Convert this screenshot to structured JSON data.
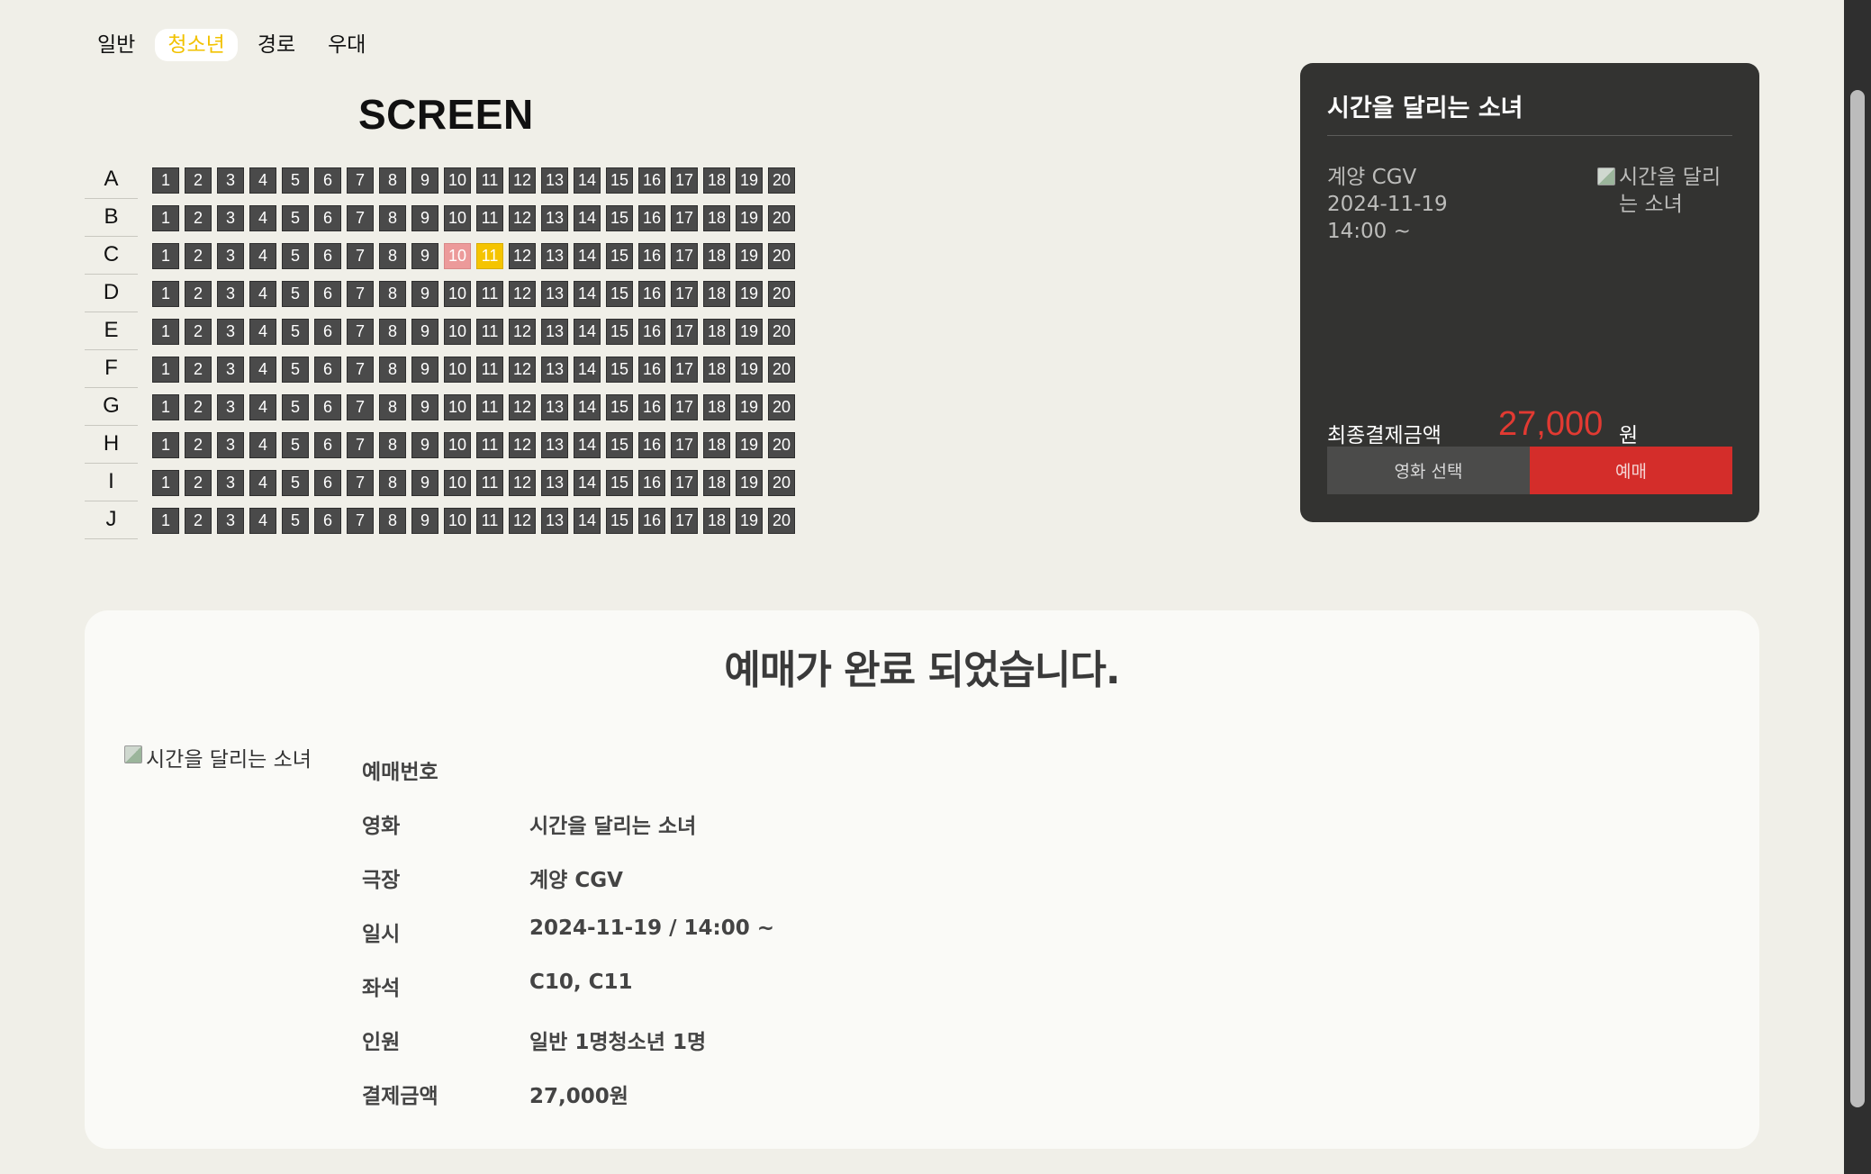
{
  "ticket_types": [
    {
      "label": "일반",
      "active": false
    },
    {
      "label": "청소년",
      "active": true
    },
    {
      "label": "경로",
      "active": false
    },
    {
      "label": "우대",
      "active": false
    }
  ],
  "screen_label": "SCREEN",
  "seat_map": {
    "rows": [
      "A",
      "B",
      "C",
      "D",
      "E",
      "F",
      "G",
      "H",
      "I",
      "J"
    ],
    "seat_numbers": [
      "1",
      "2",
      "3",
      "4",
      "5",
      "6",
      "7",
      "8",
      "9",
      "10",
      "11",
      "12",
      "13",
      "14",
      "15",
      "16",
      "17",
      "18",
      "19",
      "20"
    ],
    "reserved_seats": [
      "C10"
    ],
    "selected_seats": [
      "C11"
    ]
  },
  "summary_panel": {
    "title": "시간을 달리는 소녀",
    "theater": "계양 CGV",
    "date": "2024-11-19",
    "time": "14:00 ~",
    "poster_alt": "시간을 달리는 소녀",
    "price_label": "최종결제금액",
    "price_value": "27,000",
    "price_unit": "원",
    "movie_select_label": "영화 선택",
    "book_label": "예매"
  },
  "confirmation": {
    "title": "예매가 완료 되었습니다.",
    "poster_alt": "시간을 달리는 소녀",
    "details": [
      {
        "label": "예매번호",
        "value": ""
      },
      {
        "label": "영화",
        "value": "시간을 달리는 소녀"
      },
      {
        "label": "극장",
        "value": "계양 CGV"
      },
      {
        "label": "일시",
        "value": "2024-11-19 / 14:00 ~"
      },
      {
        "label": "좌석",
        "value": "C10, C11"
      },
      {
        "label": "인원",
        "value": "일반 1명청소년 1명"
      },
      {
        "label": "결제금액",
        "value": "27,000원"
      }
    ]
  },
  "colors": {
    "accent_yellow": "#f5c400",
    "reserved_pink": "#ec9a9a",
    "book_red": "#d42d2a",
    "price_red": "#e23a32"
  }
}
